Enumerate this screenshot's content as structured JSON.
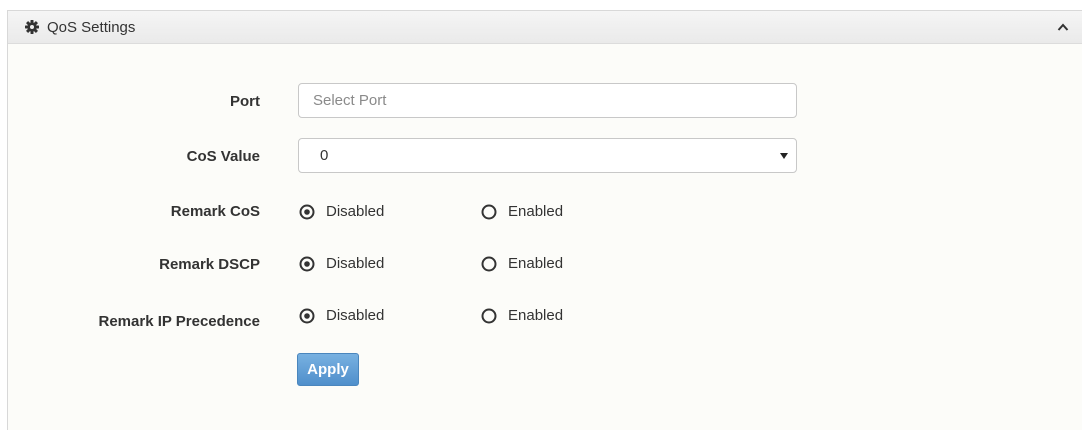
{
  "panel": {
    "title": "QoS Settings",
    "icon": "gear-icon",
    "collapse_icon": "chevron-up-icon"
  },
  "form": {
    "port": {
      "label": "Port",
      "placeholder": "Select Port",
      "value": ""
    },
    "cos_value": {
      "label": "CoS Value",
      "selected": "0"
    },
    "remark_cos": {
      "label": "Remark CoS",
      "options": [
        "Disabled",
        "Enabled"
      ],
      "selected": "Disabled"
    },
    "remark_dscp": {
      "label": "Remark DSCP",
      "options": [
        "Disabled",
        "Enabled"
      ],
      "selected": "Disabled"
    },
    "remark_ip_precedence": {
      "label": "Remark IP Precedence",
      "options": [
        "Disabled",
        "Enabled"
      ],
      "selected": "Disabled"
    },
    "apply_label": "Apply"
  },
  "colors": {
    "button": "#5a9bd5",
    "header_bg": "#efefef",
    "panel_bg": "#fcfcf9"
  }
}
